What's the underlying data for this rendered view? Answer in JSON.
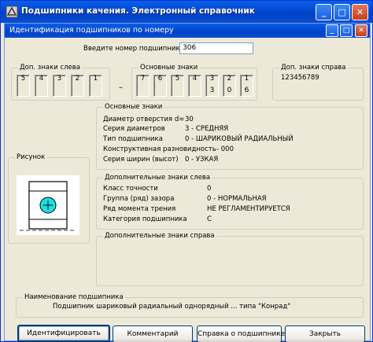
{
  "app": {
    "title": "Подшипники качения. Электронный справочник",
    "min_glyph": "_",
    "max_glyph": "□",
    "close_glyph": "✕"
  },
  "dialog": {
    "title": "Идентификация подшипников по номеру",
    "min_glyph": "_",
    "max_glyph": "□",
    "close_glyph": "✕"
  },
  "number_input": {
    "label": "Введите номер подшипника",
    "value": "306"
  },
  "left_extra": {
    "legend": "Доп. знаки слева",
    "digits": [
      "5",
      "4",
      "3",
      "2",
      "1"
    ]
  },
  "dash": "–",
  "main_signs": {
    "legend": "Основные знаки",
    "digits": [
      "7",
      "6",
      "5",
      "4",
      "3",
      "2",
      "1"
    ],
    "values": [
      "",
      "",
      "",
      "",
      "3",
      "0",
      "6"
    ]
  },
  "right_extra": {
    "legend": "Доп. знаки справа",
    "value": "123456789"
  },
  "main_info": {
    "legend": "Основные знаки",
    "rows": [
      {
        "label": "Диаметр отверстия d=",
        "value": "30"
      },
      {
        "label": "Серия диаметров",
        "value": "3  -  СРЕДНЯЯ"
      },
      {
        "label": "Тип подшипника",
        "value": "0  -  ШАРИКОВЫЙ РАДИАЛЬНЫЙ"
      },
      {
        "label": "Конструктивная разновидность",
        "value": "-  000"
      },
      {
        "label": "Серия ширин (высот)",
        "value": "0  -  УЗКАЯ"
      }
    ]
  },
  "picture": {
    "legend": "Рисунок"
  },
  "left_info": {
    "legend": "Дополнительные знаки слева",
    "rows": [
      {
        "label": "Класс точности",
        "value": "0"
      },
      {
        "label": "Группа (ряд) зазора",
        "value": "0 - НОРМАЛЬНАЯ"
      },
      {
        "label": "Ряд момента трения",
        "value": "НЕ РЕГЛАМЕНТИРУЕТСЯ"
      },
      {
        "label": "Категория подшипника",
        "value": "С"
      }
    ]
  },
  "right_info": {
    "legend": "Дополнительные знаки справа"
  },
  "name_group": {
    "legend": "Наименование подшипника",
    "text": "Подшипник шариковый радиальный однорядный ... типа \"Конрад\""
  },
  "buttons": {
    "identify": "Идентифицировать",
    "comment": "Комментарий",
    "reference": "Справка о подшипнике",
    "close": "Закрыть"
  }
}
